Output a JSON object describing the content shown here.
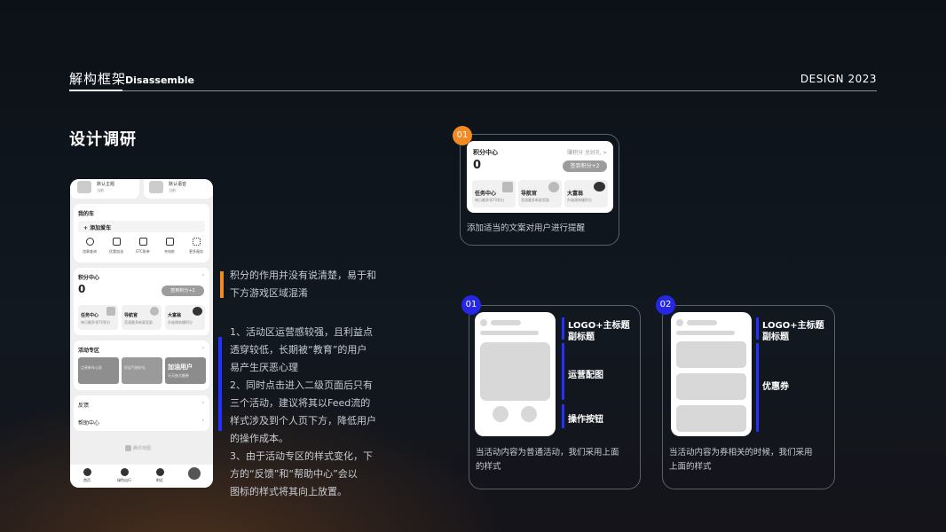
{
  "header": {
    "title_cn": "解构框架",
    "title_en": "Disassemble",
    "brand": "DESIGN 2023"
  },
  "section_title": "设计调研",
  "phone": {
    "top_items": [
      "默认主题",
      "默认语音"
    ],
    "top_sub": "当前",
    "car_title": "我的车",
    "add_car": "+ 添加爱车",
    "car_icons": [
      {
        "label": "违章查询",
        "icon": "camera-icon"
      },
      {
        "label": "优惠加油",
        "icon": "fuel-icon"
      },
      {
        "label": "ETC账单",
        "icon": "etc-icon"
      },
      {
        "label": "充电桩",
        "icon": "charger-icon"
      },
      {
        "label": "更多服务",
        "icon": "grid-icon"
      }
    ],
    "points_title": "积分中心",
    "points_value": "0",
    "checkin_btn": "签到积分+2",
    "points_tiles": [
      {
        "title": "任务中心",
        "sub": "每日最多领70积分"
      },
      {
        "title": "导航官",
        "sub": "竞速最多新星奖励"
      },
      {
        "title": "大富翁",
        "sub": "升级建筑赚积分"
      }
    ],
    "activity_title": "活动专区",
    "activity_banners": [
      "点亮新年心愿",
      "好运气抽好礼",
      "加油用户"
    ],
    "activity_banner_sub": "天天抽大额券",
    "menu": [
      "反馈",
      "帮助中心"
    ],
    "watermark": "腾讯地图",
    "tabbar": [
      "首页",
      "绿色出行",
      "附近",
      ""
    ]
  },
  "notes": {
    "note1": [
      "积分的作用并没有说清楚，易于和",
      "下方游戏区域混淆"
    ],
    "note2": [
      "1、活动区运营感较强，且利益点",
      "透穿较低，长期被“教育”的用户",
      "易产生厌恶心理",
      "2、同时点击进入二级页面后只有",
      "三个活动，建议将其以Feed流的",
      "样式涉及到个人页下方，降低用户",
      "的操作成本。",
      "3、由于活动专区的样式变化，下",
      "方的“反馈”和“帮助中心”会以",
      "图标的样式将其向上放置。"
    ]
  },
  "card1": {
    "badge": "01",
    "title": "积分中心",
    "right_link": "赚积分 兑好礼 >",
    "value": "0",
    "button": "签到积分+2",
    "tiles": [
      {
        "title": "任务中心",
        "sub": "每日最多领70积分"
      },
      {
        "title": "导航官",
        "sub": "竞速最多新星奖励"
      },
      {
        "title": "大富翁",
        "sub": "升级建筑赚积分"
      }
    ],
    "caption": "添加适当的文案对用户进行提醒"
  },
  "card2": {
    "badge": "01",
    "labels": [
      "LOGO+主标题",
      "副标题",
      "运营配图",
      "操作按钮"
    ],
    "caption": [
      "当活动内容为普通活动，我们采用上面",
      "的样式"
    ]
  },
  "card3": {
    "badge": "02",
    "labels": [
      "LOGO+主标题",
      "副标题",
      "优惠券"
    ],
    "caption": [
      "当活动内容为券相关的时候，我们采用",
      "上面的样式"
    ]
  },
  "colors": {
    "orange": "#f08a24",
    "blue": "#2430ff",
    "accent_blue_badge": "#2626e6"
  }
}
